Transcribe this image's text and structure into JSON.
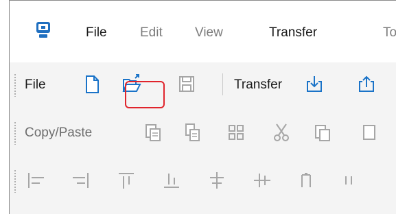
{
  "menu": {
    "file": "File",
    "edit": "Edit",
    "view": "View",
    "transfer": "Transfer",
    "tools_partial": "To"
  },
  "toolbars": {
    "file": {
      "label": "File",
      "buttons": [
        "new-file",
        "open-file",
        "save-file"
      ]
    },
    "transfer": {
      "label": "Transfer",
      "buttons": [
        "receive",
        "send"
      ]
    },
    "copy_paste": {
      "label": "Copy/Paste",
      "buttons": [
        "copy",
        "paste-special",
        "select-all",
        "cut",
        "paste",
        "clipboard"
      ]
    },
    "align": {
      "buttons": [
        "align-left",
        "align-right",
        "align-top",
        "align-bottom",
        "center-horizontal",
        "center-vertical",
        "align-baseline",
        "distribute"
      ]
    }
  },
  "colors": {
    "accent_blue": "#1a73c8",
    "disabled_gray": "#a6a6a6",
    "highlight_red": "#e0242c"
  }
}
